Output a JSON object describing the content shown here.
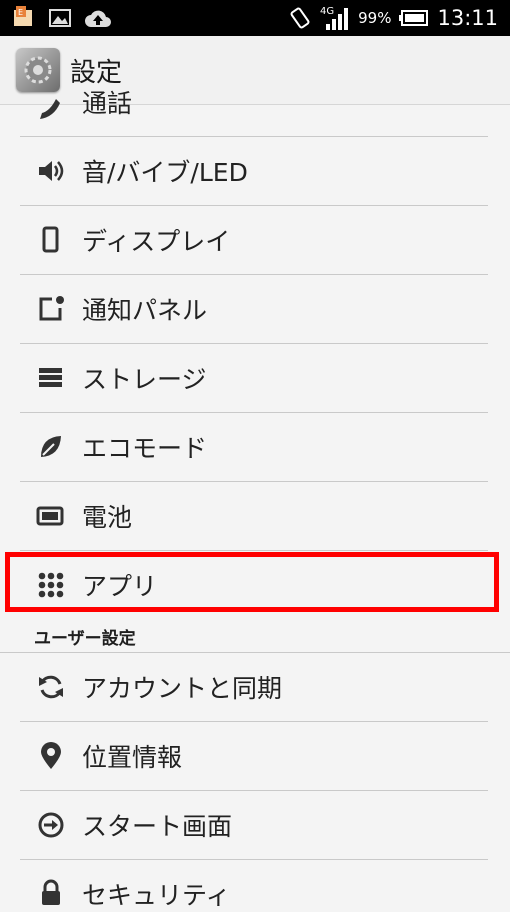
{
  "status_bar": {
    "network": "4G",
    "battery_percent": "99%",
    "time": "13:11"
  },
  "action_bar": {
    "title": "設定",
    "icon": "settings-gear-app-icon"
  },
  "items": [
    {
      "label": "通話",
      "icon": "phone-icon"
    },
    {
      "label": "音/バイブ/LED",
      "icon": "speaker-icon"
    },
    {
      "label": "ディスプレイ",
      "icon": "display-icon"
    },
    {
      "label": "通知パネル",
      "icon": "notification-icon"
    },
    {
      "label": "ストレージ",
      "icon": "storage-icon"
    },
    {
      "label": "エコモード",
      "icon": "leaf-icon"
    },
    {
      "label": "電池",
      "icon": "battery-icon"
    },
    {
      "label": "アプリ",
      "icon": "apps-grid-icon"
    }
  ],
  "section_header": "ユーザー設定",
  "user_items": [
    {
      "label": "アカウントと同期",
      "icon": "sync-icon"
    },
    {
      "label": "位置情報",
      "icon": "location-pin-icon"
    },
    {
      "label": "スタート画面",
      "icon": "start-screen-icon"
    },
    {
      "label": "セキュリティ",
      "icon": "lock-icon"
    }
  ],
  "highlight_color": "#ff0000"
}
